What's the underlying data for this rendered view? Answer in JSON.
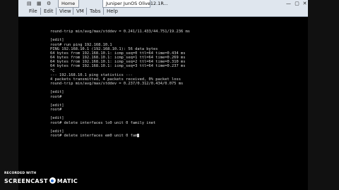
{
  "toolbar": {
    "icons": [
      "▤",
      "▦",
      "⚙",
      "VM",
      "Tab",
      "Help"
    ],
    "buttons": [
      "File",
      "Edit",
      "View",
      "VM",
      "Tabs",
      "Help"
    ],
    "tabs": {
      "home": "Home",
      "active": "Juniper JunOS Olive12.1R..."
    },
    "window_controls": [
      "—",
      "▢",
      "✕"
    ]
  },
  "terminal": {
    "lines": [
      "round-trip min/avg/max/stddev = 0.241/11.433/44.751/19.236 ms",
      "",
      "[edit]",
      "root# run ping 192.168.10.1",
      "PING 192.168.10.1 (192.168.10.1): 56 data bytes",
      "64 bytes from 192.168.10.1: icmp_seq=0 ttl=64 time=0.434 ms",
      "64 bytes from 192.168.10.1: icmp_seq=1 ttl=64 time=0.269 ms",
      "64 bytes from 192.168.10.1: icmp_seq=2 ttl=64 time=0.310 ms",
      "64 bytes from 192.168.10.1: icmp_seq=3 ttl=64 time=0.237 ms",
      "^C",
      "--- 192.168.10.1 ping statistics ---",
      "4 packets transmitted, 4 packets received, 0% packet loss",
      "round-trip min/avg/max/stddev = 0.237/0.312/0.434/0.075 ms",
      "",
      "[edit]",
      "root#",
      "",
      "[edit]",
      "root#",
      "",
      "[edit]",
      "root# delete interfaces lo0 unit 0 family inet",
      "",
      "[edit]",
      "root# delete interfaces em0 unit 0 fam"
    ]
  },
  "watermark": {
    "top": "RECORDED WITH",
    "left": "SCREENCAST",
    "right": "MATIC"
  }
}
